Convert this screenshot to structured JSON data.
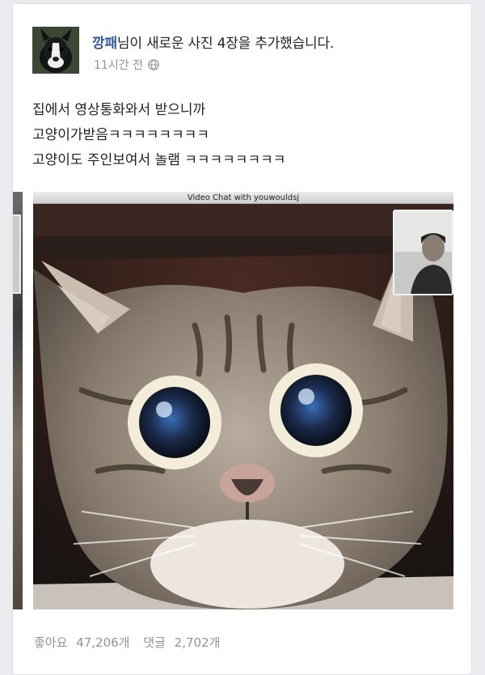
{
  "post": {
    "author_name": "깡패",
    "action_text": "님이 새로운 사진 4장을 추가했습니다.",
    "timestamp": "11시간 전",
    "privacy_icon": "globe-icon",
    "text_lines": [
      "집에서 영상통화와서 받으니까",
      "고양이가받음ㅋㅋㅋㅋㅋㅋㅋㅋ",
      "고양이도 주인보여서 놀램 ㅋㅋㅋㅋㅋㅋㅋㅋ"
    ]
  },
  "photo": {
    "window_title": "Video Chat with youwouldsj"
  },
  "footer": {
    "likes_label": "좋아요",
    "likes_count": "47,206개",
    "comments_label": "댓글",
    "comments_count": "2,702개"
  },
  "colors": {
    "background": "#e9ebee",
    "card": "#ffffff",
    "author_link": "#365899",
    "meta_text": "#90949c"
  }
}
